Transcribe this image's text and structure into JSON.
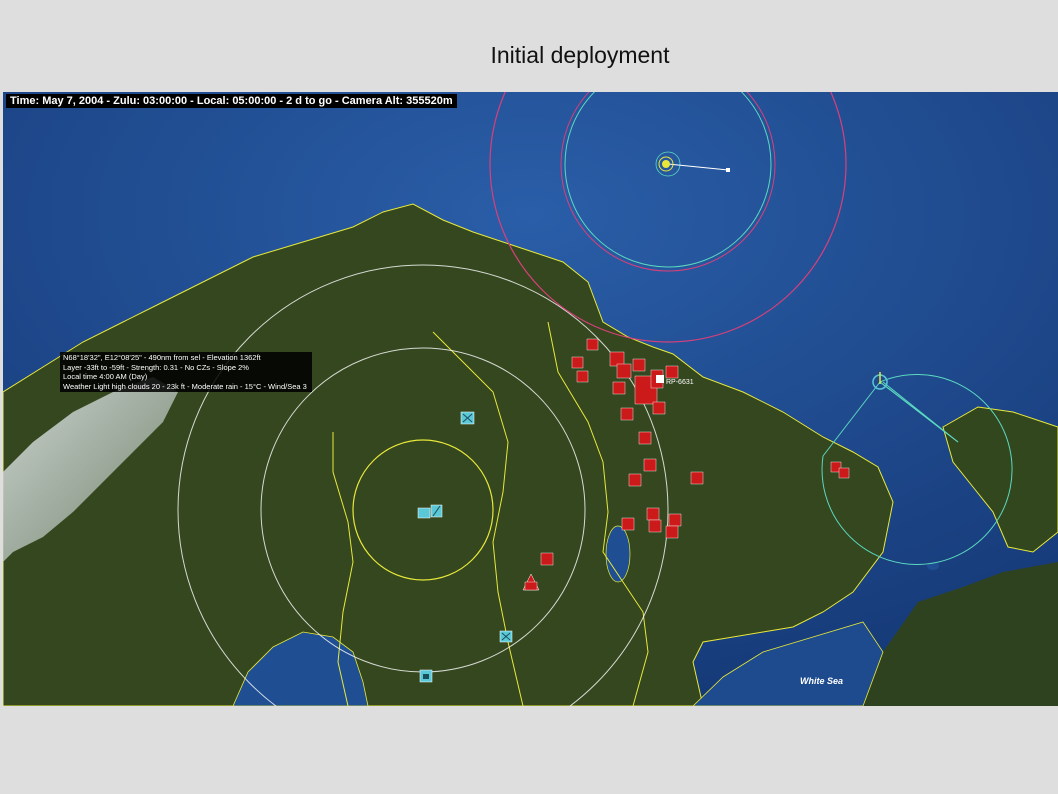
{
  "slide": {
    "title": "Initial deployment"
  },
  "hud": {
    "status": "Time: May 7, 2004 - Zulu: 03:00:00 - Local: 05:00:00 - 2 d to go -  Camera Alt: 355520m"
  },
  "cursor_info": {
    "lines": [
      "N68°18'32\", E12°08'25\" - 490nm from sel - Elevation 1362ft",
      "Layer -33ft to -59ft - Strength: 0.31 - No CZs - Slope 2%",
      "Local time 4:00 AM (Day)",
      "Weather Light high clouds 20 - 23k ft - Moderate rain - 15°C - Wind/Sea 3"
    ]
  },
  "map": {
    "sea_label": "White Sea",
    "unit_label": "RP-6631",
    "colors": {
      "sea": "#1f4f92",
      "land": "#34471f",
      "border": "#e8e83a",
      "hostile": "#cc1a1a",
      "friendly": "#5bc8d8"
    }
  }
}
